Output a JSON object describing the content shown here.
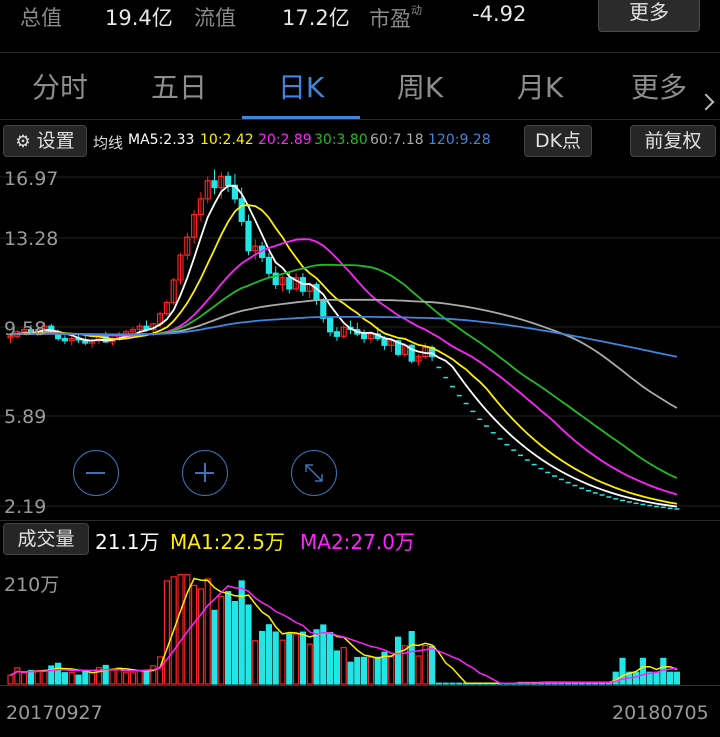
{
  "stats": [
    {
      "label": "总值",
      "value": "19.4亿"
    },
    {
      "label": "流值",
      "value": "17.2亿"
    },
    {
      "label": "市盈",
      "value": "-4.92",
      "sup": "动"
    }
  ],
  "more_top": "更多",
  "tabs": [
    {
      "label": "分时"
    },
    {
      "label": "五日"
    },
    {
      "label": "日K"
    },
    {
      "label": "周K"
    },
    {
      "label": "月K"
    },
    {
      "label": "更多"
    }
  ],
  "active_tab": "日K",
  "toolbar": {
    "settings": "设置",
    "ma_title": "均线",
    "ma": [
      {
        "text": "MA5:2.33",
        "color": "#ffffff"
      },
      {
        "text": "10:2.42",
        "color": "#ffee00"
      },
      {
        "text": "20:2.89",
        "color": "#ff22ff"
      },
      {
        "text": "30:3.80",
        "color": "#22bb22"
      },
      {
        "text": "60:7.18",
        "color": "#aaaaaa"
      },
      {
        "text": "120:9.28",
        "color": "#3e86e0"
      }
    ],
    "dk": "DK点",
    "adjust": "前复权"
  },
  "price_axis": [
    "16.97",
    "13.28",
    "9.58",
    "5.89",
    "2.19"
  ],
  "volume": {
    "label": "成交量",
    "value": "21.1万",
    "ma1": "MA1:22.5万",
    "ma2": "MA2:27.0万",
    "axis": "210万"
  },
  "dates": {
    "start": "20170927",
    "end": "20180705"
  },
  "colors": {
    "up": "#ff2222",
    "down": "#22e6e6",
    "accent": "#3e86e0"
  },
  "icons": {
    "zoom_out": "minus-circle-icon",
    "zoom_in": "plus-circle-icon",
    "fullscreen": "expand-icon",
    "settings": "gear-icon"
  },
  "chart_data": {
    "type": "candlestick",
    "y_range": [
      2.19,
      16.97
    ],
    "ohlc": [
      [
        9.85,
        10.05,
        9.6,
        9.9
      ],
      [
        9.9,
        10.2,
        9.8,
        10.1
      ],
      [
        10.1,
        10.3,
        9.95,
        10.2
      ],
      [
        10.2,
        10.4,
        10.0,
        10.05
      ],
      [
        10.05,
        10.3,
        9.9,
        10.2
      ],
      [
        10.2,
        10.5,
        10.1,
        10.35
      ],
      [
        10.35,
        10.45,
        10.0,
        10.1
      ],
      [
        10.1,
        10.2,
        9.7,
        9.8
      ],
      [
        9.8,
        9.95,
        9.55,
        9.7
      ],
      [
        9.7,
        9.9,
        9.5,
        9.8
      ],
      [
        9.8,
        10.0,
        9.6,
        9.75
      ],
      [
        9.75,
        9.9,
        9.5,
        9.6
      ],
      [
        9.6,
        9.8,
        9.4,
        9.7
      ],
      [
        9.7,
        10.0,
        9.55,
        9.9
      ],
      [
        9.9,
        10.1,
        9.6,
        9.65
      ],
      [
        9.65,
        9.85,
        9.5,
        9.8
      ],
      [
        9.8,
        10.1,
        9.7,
        10.0
      ],
      [
        10.0,
        10.2,
        9.8,
        10.1
      ],
      [
        10.1,
        10.3,
        9.9,
        10.2
      ],
      [
        10.2,
        10.5,
        10.0,
        10.35
      ],
      [
        10.35,
        10.6,
        10.1,
        10.2
      ],
      [
        10.2,
        10.5,
        9.9,
        10.45
      ],
      [
        10.45,
        11.0,
        10.3,
        10.9
      ],
      [
        10.9,
        11.5,
        10.8,
        11.4
      ],
      [
        11.4,
        12.5,
        11.3,
        12.4
      ],
      [
        12.4,
        13.6,
        12.2,
        13.5
      ],
      [
        13.5,
        14.5,
        13.3,
        14.3
      ],
      [
        14.3,
        15.5,
        14.0,
        15.3
      ],
      [
        15.3,
        16.3,
        15.0,
        16.0
      ],
      [
        16.0,
        17.0,
        15.8,
        16.8
      ],
      [
        16.8,
        17.3,
        16.2,
        16.5
      ],
      [
        16.5,
        17.2,
        16.0,
        17.0
      ],
      [
        17.0,
        17.2,
        16.3,
        16.6
      ],
      [
        16.6,
        17.1,
        15.8,
        16.0
      ],
      [
        16.0,
        16.5,
        14.8,
        15.0
      ],
      [
        15.0,
        15.3,
        13.5,
        13.7
      ],
      [
        13.7,
        14.2,
        13.3,
        13.9
      ],
      [
        13.9,
        14.1,
        13.2,
        13.4
      ],
      [
        13.4,
        13.6,
        12.5,
        12.7
      ],
      [
        12.7,
        13.0,
        12.0,
        12.2
      ],
      [
        12.2,
        12.6,
        11.9,
        12.5
      ],
      [
        12.5,
        12.8,
        11.8,
        12.0
      ],
      [
        12.0,
        12.7,
        11.9,
        12.5
      ],
      [
        12.5,
        12.7,
        11.7,
        11.9
      ],
      [
        11.9,
        12.3,
        11.6,
        12.2
      ],
      [
        12.2,
        12.3,
        11.3,
        11.5
      ],
      [
        11.5,
        11.6,
        10.5,
        10.7
      ],
      [
        10.7,
        10.8,
        9.9,
        10.1
      ],
      [
        10.1,
        10.3,
        9.7,
        9.9
      ],
      [
        9.9,
        10.4,
        9.8,
        10.3
      ],
      [
        10.3,
        10.6,
        10.0,
        10.2
      ],
      [
        10.2,
        10.5,
        9.9,
        10.0
      ],
      [
        10.0,
        10.2,
        9.6,
        9.8
      ],
      [
        9.8,
        10.1,
        9.6,
        10.0
      ],
      [
        10.0,
        10.3,
        9.7,
        9.8
      ],
      [
        9.8,
        9.9,
        9.3,
        9.5
      ],
      [
        9.5,
        9.8,
        9.2,
        9.7
      ],
      [
        9.7,
        9.75,
        9.0,
        9.1
      ],
      [
        9.1,
        9.6,
        9.0,
        9.5
      ],
      [
        9.5,
        9.55,
        8.7,
        8.8
      ],
      [
        8.8,
        9.1,
        8.6,
        9.0
      ],
      [
        9.0,
        9.6,
        8.9,
        9.4
      ],
      [
        9.4,
        9.5,
        8.8,
        9.0
      ]
    ],
    "limit_down_tail": [
      8.55,
      8.1,
      7.7,
      7.3,
      6.95,
      6.6,
      6.25,
      5.95,
      5.65,
      5.38,
      5.12,
      4.88,
      4.65,
      4.44,
      4.24,
      4.06,
      3.89,
      3.73,
      3.58,
      3.44,
      3.31,
      3.19,
      3.08,
      2.98,
      2.89,
      2.8,
      2.72,
      2.65,
      2.58,
      2.52,
      2.47,
      2.42,
      2.38,
      2.34,
      2.3,
      2.27
    ],
    "volume_axis": "210万"
  }
}
